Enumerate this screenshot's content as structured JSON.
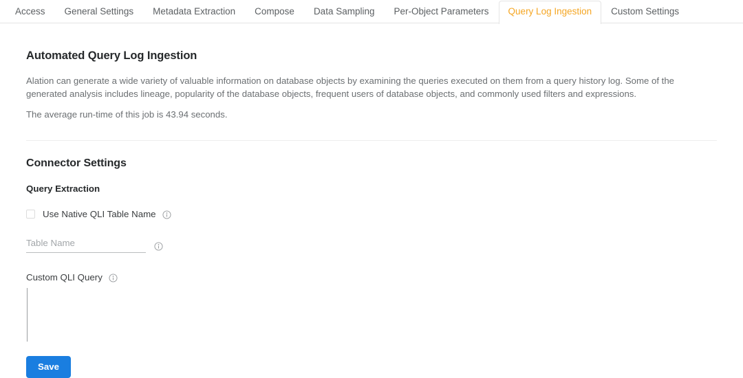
{
  "colors": {
    "accent_orange": "#f5a623",
    "primary_blue": "#1a7ee0",
    "text_dark": "#25282a",
    "text_muted": "#6b6f72",
    "border_light": "#e4e4e4"
  },
  "tabs": [
    {
      "label": "Access",
      "active": false
    },
    {
      "label": "General Settings",
      "active": false
    },
    {
      "label": "Metadata Extraction",
      "active": false
    },
    {
      "label": "Compose",
      "active": false
    },
    {
      "label": "Data Sampling",
      "active": false
    },
    {
      "label": "Per-Object Parameters",
      "active": false
    },
    {
      "label": "Query Log Ingestion",
      "active": true
    },
    {
      "label": "Custom Settings",
      "active": false
    }
  ],
  "main": {
    "page_title": "Automated Query Log Ingestion",
    "intro_paragraph": "Alation can generate a wide variety of valuable information on database objects by examining the queries executed on them from a query history log. Some of the generated analysis includes lineage, popularity of the database objects, frequent users of database objects, and commonly used filters and expressions.",
    "runtime_text": "The average run-time of this job is 43.94 seconds.",
    "section_title": "Connector Settings",
    "subsection_title": "Query Extraction",
    "native_table_checkbox": {
      "label": "Use Native QLI Table Name",
      "checked": false,
      "info_icon": "info-circle-icon"
    },
    "table_name_field": {
      "placeholder": "Table Name",
      "value": "",
      "info_icon": "info-circle-icon"
    },
    "custom_qli_query": {
      "label": "Custom QLI Query",
      "value": "",
      "placeholder": "",
      "info_icon": "info-circle-icon"
    },
    "save_label": "Save"
  }
}
